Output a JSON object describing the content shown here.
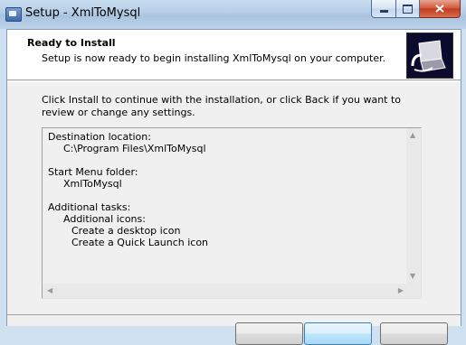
{
  "window": {
    "title": "Setup - XmlToMysql"
  },
  "header": {
    "title": "Ready to Install",
    "subtitle": "Setup is now ready to begin installing XmlToMysql on your computer.",
    "image_icon": "installer-box-icon"
  },
  "content": {
    "intro": "Click Install to continue with the installation, or click Back if you want to review or change any settings.",
    "memo": {
      "destination_label": "Destination location:",
      "destination_value": "C:\\Program Files\\XmlToMysql",
      "start_menu_label": "Start Menu folder:",
      "start_menu_value": "XmlToMysql",
      "tasks_label": "Additional tasks:",
      "tasks_group": "Additional icons:",
      "task_1": "Create a desktop icon",
      "task_2": "Create a Quick Launch icon"
    }
  },
  "icons": [
    "setup-app-icon",
    "minimize-icon",
    "maximize-icon",
    "close-icon",
    "installer-box-icon",
    "scroll-up-icon",
    "scroll-down-icon",
    "scroll-left-icon",
    "scroll-right-icon"
  ]
}
